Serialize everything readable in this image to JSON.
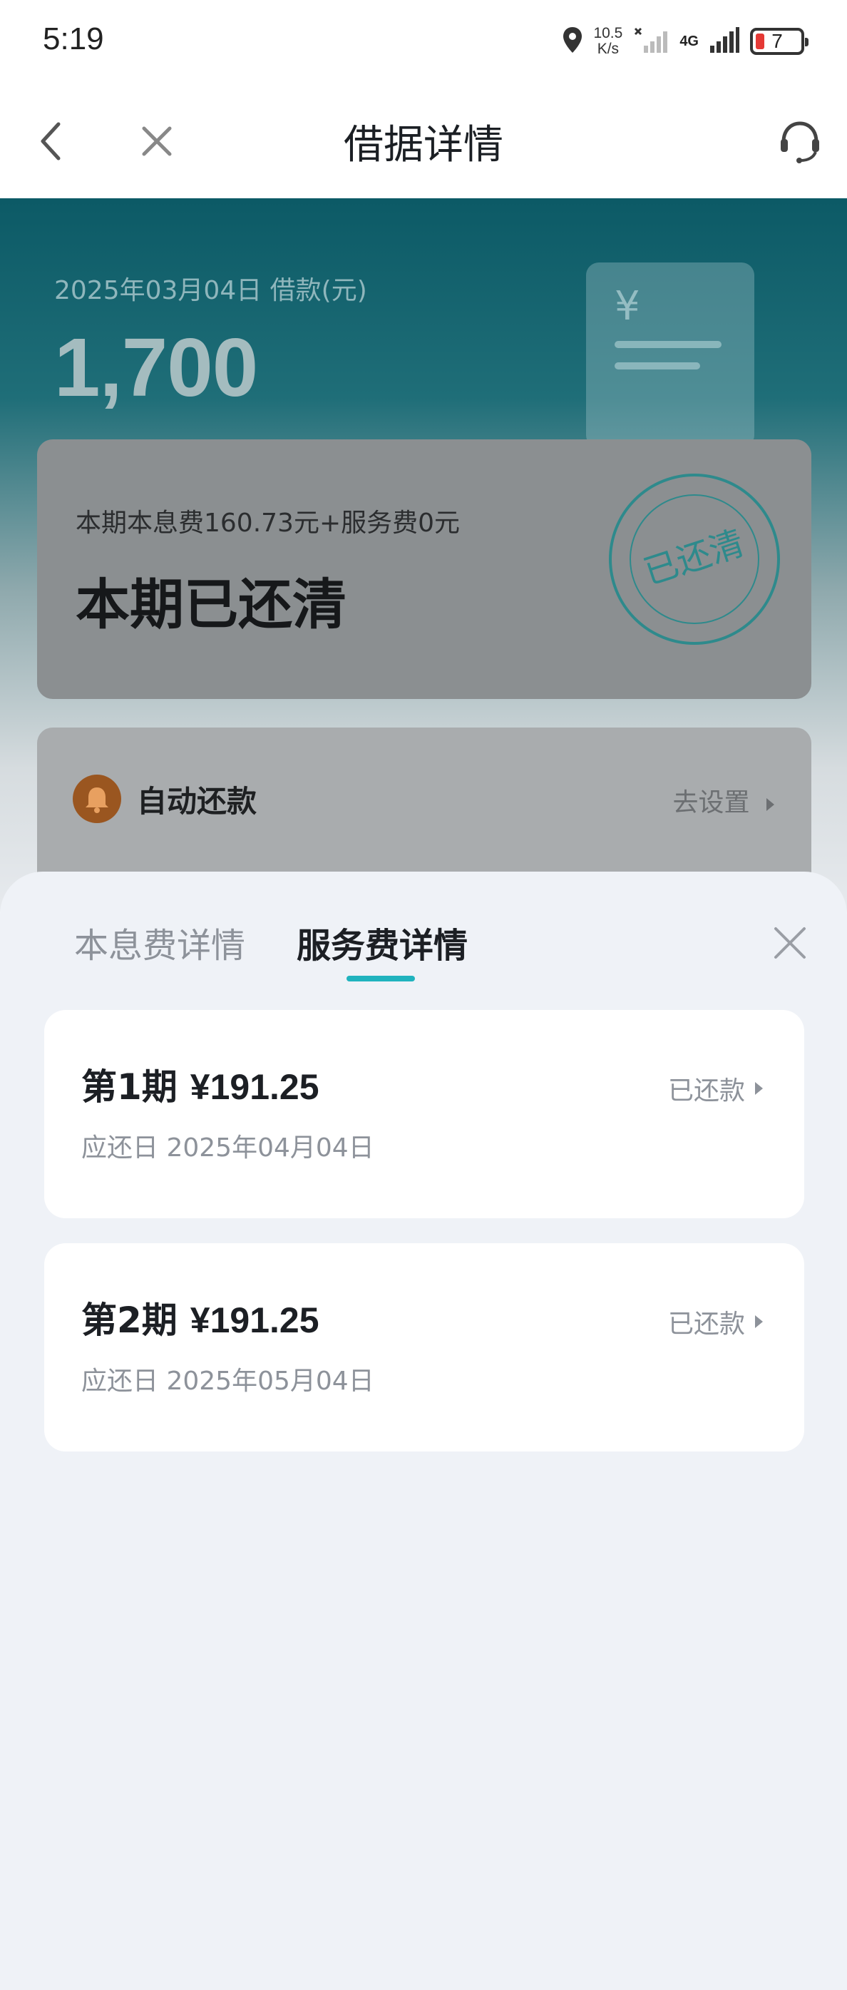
{
  "status_bar": {
    "time": "5:19",
    "net_speed_value": "10.5",
    "net_speed_unit": "K/s",
    "network_type": "4G",
    "battery_level": "7",
    "icons": [
      "location-icon",
      "wifi-off-icon",
      "signal-icon",
      "battery-icon"
    ]
  },
  "nav": {
    "title": "借据详情",
    "icons": [
      "back-icon",
      "close-icon",
      "customer-service-icon"
    ]
  },
  "loan": {
    "date_label": "2025年03月04日 借款(元)",
    "amount": "1,700"
  },
  "summary": {
    "detail_line": "本期本息费160.73元+服务费0元",
    "status": "本期已还清",
    "stamp_text": "已还清"
  },
  "auto_repay": {
    "label": "自动还款",
    "link": "去设置"
  },
  "sheet": {
    "tabs": [
      {
        "label": "本息费详情",
        "active": false
      },
      {
        "label": "服务费详情",
        "active": true
      }
    ],
    "periods": [
      {
        "title": "第1期",
        "amount": "¥191.25",
        "due_label": "应还日",
        "due_date": "2025年04月04日",
        "status": "已还款"
      },
      {
        "title": "第2期",
        "amount": "¥191.25",
        "due_label": "应还日",
        "due_date": "2025年05月04日",
        "status": "已还款"
      }
    ]
  },
  "colors": {
    "accent": "#20b3be",
    "hero_top": "#0c5a66",
    "sheet_bg": "#eff2f7",
    "muted_text": "#8d929a",
    "primary_text": "#1c1f24"
  }
}
